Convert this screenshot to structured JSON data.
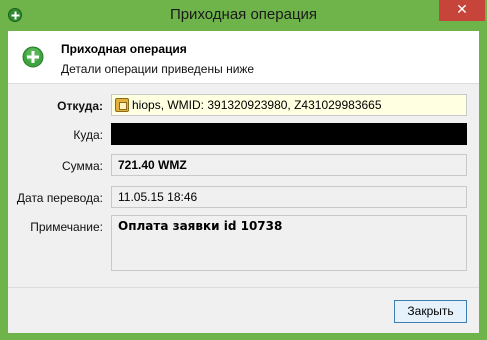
{
  "window": {
    "title": "Приходная операция",
    "close_glyph": "✕"
  },
  "header": {
    "title": "Приходная операция",
    "subtitle": "Детали операции приведены ниже",
    "icon": "plus-circle-icon"
  },
  "form": {
    "from_label": "Откуда:",
    "from_value": "hiops, WMID: 391320923980, Z431029983665",
    "to_label": "Куда:",
    "to_value": "",
    "amount_label": "Сумма:",
    "amount_value": "721.40 WMZ",
    "date_label": "Дата перевода:",
    "date_value": "11.05.15 18:46",
    "note_label": "Примечание:",
    "note_value": "Оплата заявки id 10738"
  },
  "footer": {
    "close_label": "Закрыть"
  },
  "colors": {
    "title_bar": "#6fb44a",
    "close_button": "#c7443a",
    "from_field_bg": "#ffffe1",
    "redacted": "#000000"
  }
}
